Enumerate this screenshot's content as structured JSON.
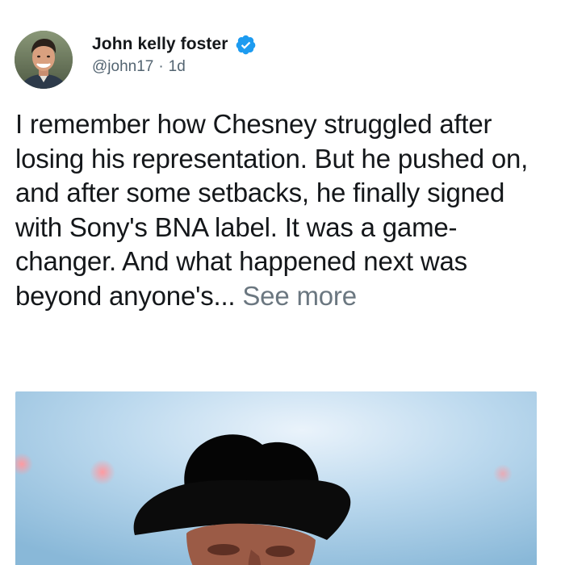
{
  "post": {
    "author": {
      "display_name": "John kelly foster",
      "handle": "@john17",
      "separator": "·",
      "time": "1d",
      "verified": true,
      "verified_color": "#1d9bf0"
    },
    "text": {
      "body": "I remember how Chesney struggled after losing his representation. But he pushed on, and after some setbacks, he finally signed with Sony's BNA label. It was a game-changer. And what happened next was beyond anyone's...",
      "see_more": "See more"
    },
    "media": {
      "type": "photo",
      "subject": "man-in-black-cowboy-hat"
    }
  },
  "icons": {
    "verified": "verified-badge-icon"
  }
}
